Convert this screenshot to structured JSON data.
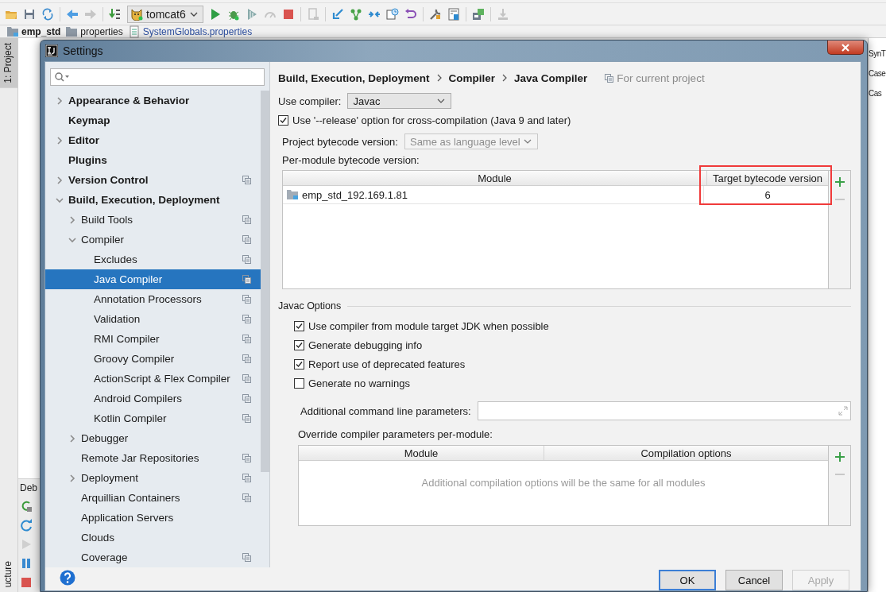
{
  "ide": {
    "run_config": "tomcat6",
    "nav_bar": [
      {
        "label": "emp_std",
        "kind": "module"
      },
      {
        "label": "properties",
        "kind": "folder"
      },
      {
        "label": "SystemGlobals.properties",
        "kind": "file"
      }
    ],
    "left_tab": "1: Project",
    "debug_tab": "Deb",
    "structure_tab": "ucture",
    "right_texts": [
      "SynT",
      "Case",
      "Cas"
    ]
  },
  "dialog": {
    "title": "Settings",
    "tree": [
      {
        "label": "Appearance & Behavior",
        "kind": "branch",
        "expanded": false,
        "shared": false,
        "selected": false
      },
      {
        "label": "Keymap",
        "kind": "leaf",
        "shared": false,
        "selected": false
      },
      {
        "label": "Editor",
        "kind": "branch",
        "expanded": false,
        "shared": false,
        "selected": false
      },
      {
        "label": "Plugins",
        "kind": "leaf",
        "shared": false,
        "selected": false
      },
      {
        "label": "Version Control",
        "kind": "branch",
        "expanded": false,
        "shared": true,
        "selected": false
      },
      {
        "label": "Build, Execution, Deployment",
        "kind": "branch",
        "expanded": true,
        "shared": false,
        "selected": false,
        "children": [
          {
            "label": "Build Tools",
            "kind": "branch",
            "expanded": false,
            "shared": true,
            "selected": false
          },
          {
            "label": "Compiler",
            "kind": "branch",
            "expanded": true,
            "shared": true,
            "selected": false,
            "children": [
              {
                "label": "Excludes",
                "kind": "leaf",
                "shared": true,
                "selected": false
              },
              {
                "label": "Java Compiler",
                "kind": "leaf",
                "shared": true,
                "selected": true
              },
              {
                "label": "Annotation Processors",
                "kind": "leaf",
                "shared": true,
                "selected": false
              },
              {
                "label": "Validation",
                "kind": "leaf",
                "shared": true,
                "selected": false
              },
              {
                "label": "RMI Compiler",
                "kind": "leaf",
                "shared": true,
                "selected": false
              },
              {
                "label": "Groovy Compiler",
                "kind": "leaf",
                "shared": true,
                "selected": false
              },
              {
                "label": "ActionScript & Flex Compiler",
                "kind": "leaf",
                "shared": true,
                "selected": false
              },
              {
                "label": "Android Compilers",
                "kind": "leaf",
                "shared": true,
                "selected": false
              },
              {
                "label": "Kotlin Compiler",
                "kind": "leaf",
                "shared": true,
                "selected": false
              }
            ]
          },
          {
            "label": "Debugger",
            "kind": "branch",
            "expanded": false,
            "shared": false,
            "selected": false
          },
          {
            "label": "Remote Jar Repositories",
            "kind": "leaf",
            "shared": true,
            "selected": false
          },
          {
            "label": "Deployment",
            "kind": "branch",
            "expanded": false,
            "shared": true,
            "selected": false
          },
          {
            "label": "Arquillian Containers",
            "kind": "leaf",
            "shared": true,
            "selected": false
          },
          {
            "label": "Application Servers",
            "kind": "leaf",
            "shared": false,
            "selected": false
          },
          {
            "label": "Clouds",
            "kind": "leaf",
            "shared": false,
            "selected": false
          },
          {
            "label": "Coverage",
            "kind": "leaf",
            "shared": true,
            "selected": false
          }
        ]
      }
    ],
    "page": {
      "breadcrumb": [
        "Build, Execution, Deployment",
        "Compiler",
        "Java Compiler"
      ],
      "scope": "For current project",
      "use_compiler": {
        "label": "Use compiler:",
        "value": "Javac"
      },
      "release_option": {
        "label": "Use '--release' option for cross-compilation (Java 9 and later)",
        "checked": true
      },
      "project_bytecode": {
        "label": "Project bytecode version:",
        "value": "Same as language level",
        "disabled": true
      },
      "per_module": {
        "label": "Per-module bytecode version:",
        "columns": [
          {
            "label": "Module",
            "highlighted": false
          },
          {
            "label": "Target bytecode version",
            "highlighted": true
          }
        ],
        "rows": [
          {
            "module": "emp_std_192.169.1.81",
            "target": "6"
          }
        ]
      },
      "javac_options": {
        "title": "Javac Options",
        "options": [
          {
            "label": "Use compiler from module target JDK when possible",
            "checked": true
          },
          {
            "label": "Generate debugging info",
            "checked": true
          },
          {
            "label": "Report use of deprecated features",
            "checked": true
          },
          {
            "label": "Generate no warnings",
            "checked": false
          }
        ],
        "additional_params": {
          "label": "Additional command line parameters:"
        },
        "override": {
          "label": "Override compiler parameters per-module:",
          "columns": [
            "Module",
            "Compilation options"
          ],
          "empty_text": "Additional compilation options will be the same for all modules"
        }
      }
    },
    "buttons": [
      {
        "label": "OK",
        "default": true,
        "disabled": false
      },
      {
        "label": "Cancel",
        "default": false,
        "disabled": false
      },
      {
        "label": "Apply",
        "default": false,
        "disabled": true
      }
    ]
  }
}
